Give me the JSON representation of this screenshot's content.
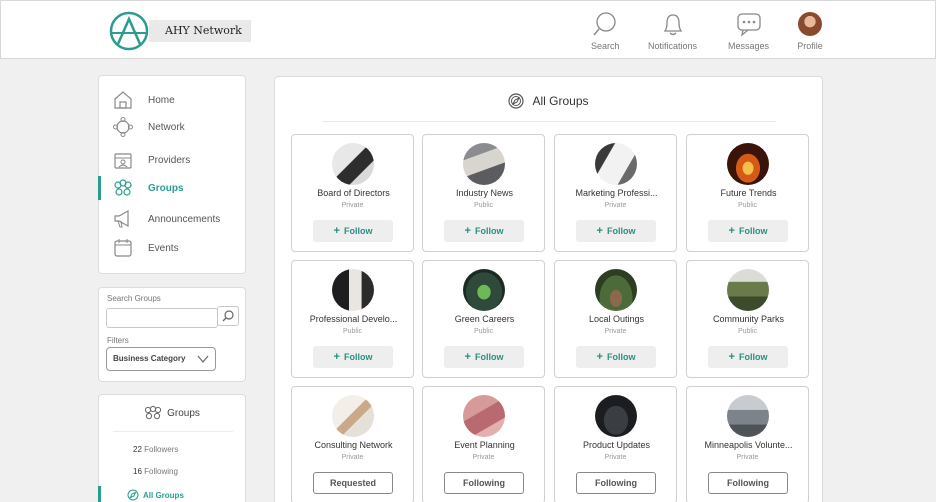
{
  "header": {
    "brand": "AHY Network",
    "nav": [
      {
        "label": "Search",
        "icon": "search-icon"
      },
      {
        "label": "Notifications",
        "icon": "bell-icon"
      },
      {
        "label": "Messages",
        "icon": "chat-icon"
      },
      {
        "label": "Profile",
        "icon": "avatar"
      }
    ]
  },
  "sidebar": {
    "items": [
      {
        "label": "Home",
        "icon": "home-icon"
      },
      {
        "label": "Network",
        "icon": "network-icon"
      },
      {
        "label": "Providers",
        "icon": "providers-icon"
      },
      {
        "label": "Groups",
        "icon": "groups-icon",
        "active": true
      },
      {
        "label": "Announcements",
        "icon": "megaphone-icon"
      },
      {
        "label": "Events",
        "icon": "calendar-icon"
      }
    ],
    "search_label": "Search Groups",
    "filters_label": "Filters",
    "filter_value": "Business Category",
    "groups_panel": {
      "title": "Groups",
      "followers_count": "22",
      "followers_label": "Followers",
      "following_count": "16",
      "following_label": "Following",
      "all_groups_label": "All Groups"
    }
  },
  "main": {
    "title": "All Groups",
    "groups": [
      {
        "name": "Board of Directors",
        "type": "Private",
        "action": "Follow"
      },
      {
        "name": "Industry News",
        "type": "Public",
        "action": "Follow"
      },
      {
        "name": "Marketing Professi...",
        "type": "Private",
        "action": "Follow"
      },
      {
        "name": "Future Trends",
        "type": "Public",
        "action": "Follow"
      },
      {
        "name": "Professional Develo...",
        "type": "Public",
        "action": "Follow"
      },
      {
        "name": "Green Careers",
        "type": "Public",
        "action": "Follow"
      },
      {
        "name": "Local Outings",
        "type": "Private",
        "action": "Follow"
      },
      {
        "name": "Community Parks",
        "type": "Public",
        "action": "Follow"
      },
      {
        "name": "Consulting Network",
        "type": "Private",
        "action": "Requested"
      },
      {
        "name": "Event Planning",
        "type": "Private",
        "action": "Following"
      },
      {
        "name": "Product Updates",
        "type": "Private",
        "action": "Following"
      },
      {
        "name": "Minneapolis Volunte...",
        "type": "Private",
        "action": "Following"
      }
    ]
  },
  "colors": {
    "accent": "#2a9d8f",
    "background": "#f0f0f0"
  }
}
